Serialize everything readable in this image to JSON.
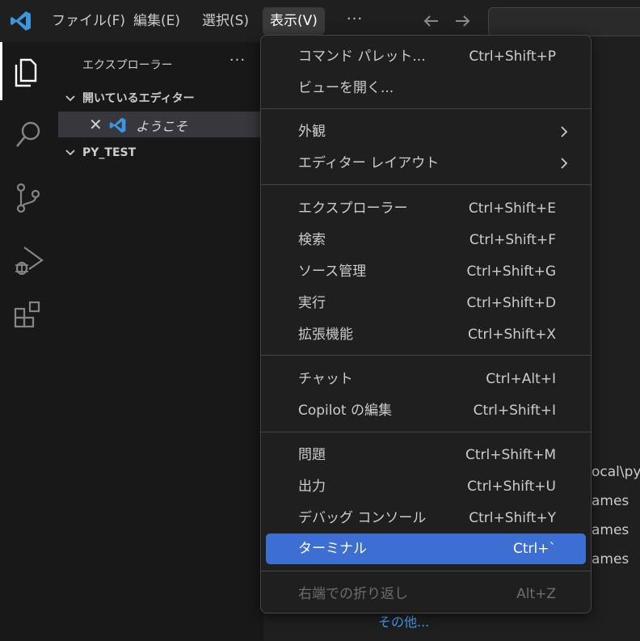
{
  "titlebar": {
    "menus": [
      {
        "label": "ファイル(F)"
      },
      {
        "label": "編集(E)"
      },
      {
        "label": "選択(S)"
      },
      {
        "label": "表示(V)"
      }
    ],
    "more": "···"
  },
  "sidebar": {
    "title": "エクスプローラー",
    "more": "···",
    "open_editors": {
      "header": "開いているエディター",
      "item": "ようこそ",
      "close": "✕"
    },
    "folder": "PY_TEST"
  },
  "editor_bg": {
    "lines": [
      "ocal\\py",
      "ames",
      "ames",
      "ames"
    ],
    "link": "その他..."
  },
  "view_menu": {
    "items": [
      {
        "label": "コマンド パレット...",
        "shortcut": "Ctrl+Shift+P"
      },
      {
        "label": "ビューを開く...",
        "shortcut": ""
      },
      {
        "label": "外観",
        "shortcut": ""
      },
      {
        "label": "エディター レイアウト",
        "shortcut": ""
      },
      {
        "label": "エクスプローラー",
        "shortcut": "Ctrl+Shift+E"
      },
      {
        "label": "検索",
        "shortcut": "Ctrl+Shift+F"
      },
      {
        "label": "ソース管理",
        "shortcut": "Ctrl+Shift+G"
      },
      {
        "label": "実行",
        "shortcut": "Ctrl+Shift+D"
      },
      {
        "label": "拡張機能",
        "shortcut": "Ctrl+Shift+X"
      },
      {
        "label": "チャット",
        "shortcut": "Ctrl+Alt+I"
      },
      {
        "label": "Copilot の編集",
        "shortcut": "Ctrl+Shift+I"
      },
      {
        "label": "問題",
        "shortcut": "Ctrl+Shift+M"
      },
      {
        "label": "出力",
        "shortcut": "Ctrl+Shift+U"
      },
      {
        "label": "デバッグ コンソール",
        "shortcut": "Ctrl+Shift+Y"
      },
      {
        "label": "ターミナル",
        "shortcut": "Ctrl+`"
      },
      {
        "label": "右端での折り返し",
        "shortcut": "Alt+Z"
      }
    ]
  },
  "colors": {
    "accent": "#3c6fd1",
    "vscode_blue": "#3a96dd",
    "link": "#4aa3ff"
  }
}
